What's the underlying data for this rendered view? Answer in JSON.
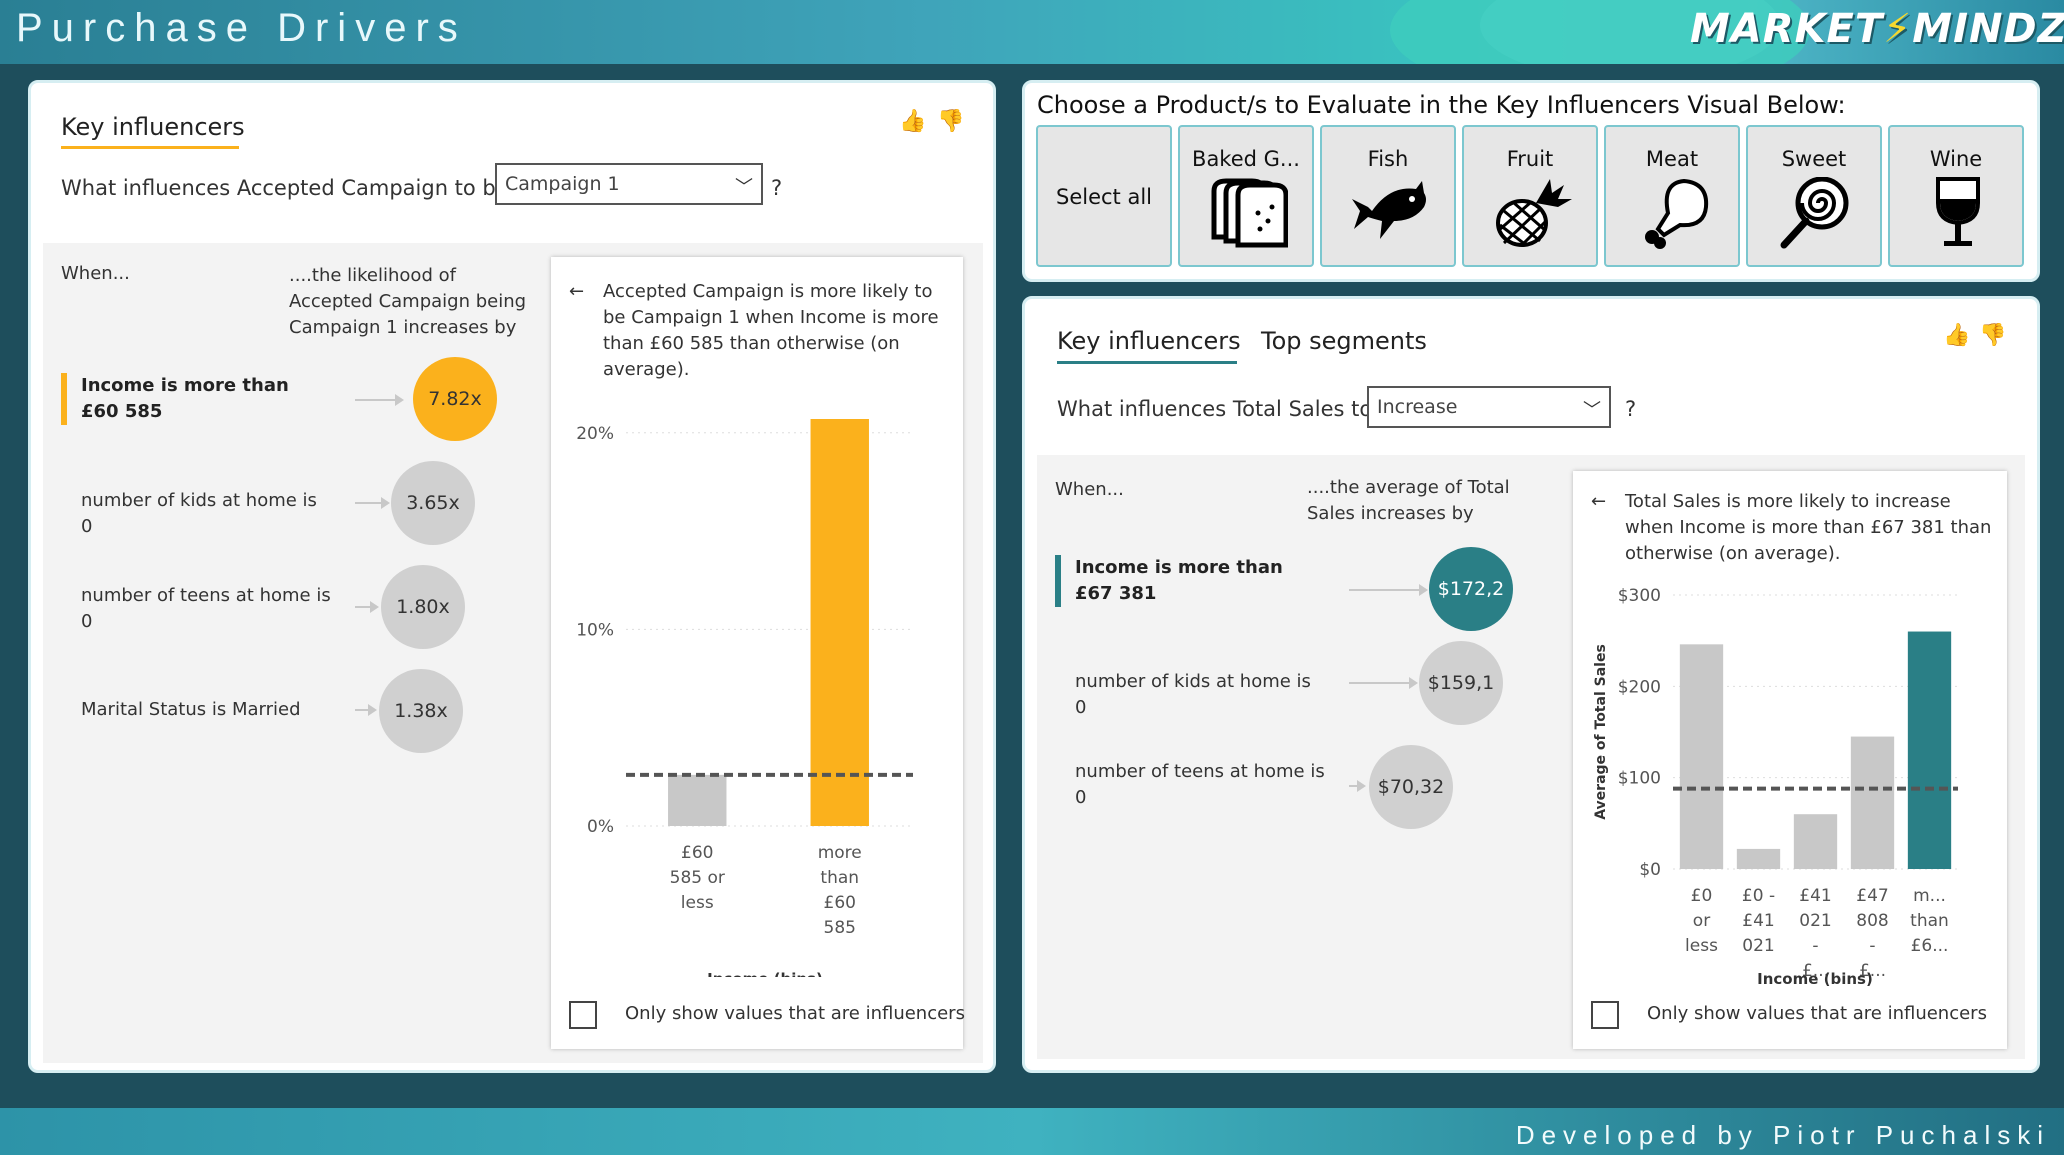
{
  "header": {
    "title": "Purchase Drivers",
    "logo": "MARKETMINDZ",
    "accent_color": "#f7d82e"
  },
  "footer": {
    "credit": "Developed by Piotr Puchalski"
  },
  "left": {
    "tab": "Key influencers",
    "question_prefix": "What influences Accepted Campaign to be",
    "dropdown_value": "Campaign 1",
    "question_suffix": "?",
    "col_when": "When...",
    "col_effect": "....the likelihood of Accepted Campaign being Campaign 1 increases by",
    "influencers": [
      {
        "label": "Income is more than £60 585",
        "value": "7.82x",
        "color": "#fbb11c"
      },
      {
        "label": "number of kids at home is 0",
        "value": "3.65x",
        "color": "#d0d0d0"
      },
      {
        "label": "number of teens at home is 0",
        "value": "1.80x",
        "color": "#d0d0d0"
      },
      {
        "label": "Marital Status is Married",
        "value": "1.38x",
        "color": "#d0d0d0"
      }
    ],
    "detail_text": "Accepted Campaign is more likely to be Campaign 1 when Income is more than £60 585 than otherwise (on average).",
    "back_icon": "arrow-left-icon",
    "only_influencers": "Only show values that are influencers"
  },
  "right": {
    "slicer_title": "Choose a Product/s to Evaluate in the Key Influencers Visual Below:",
    "products": [
      {
        "label": "Select all",
        "icon": ""
      },
      {
        "label": "Baked G...",
        "icon": "bread-icon"
      },
      {
        "label": "Fish",
        "icon": "fish-icon"
      },
      {
        "label": "Fruit",
        "icon": "pineapple-icon"
      },
      {
        "label": "Meat",
        "icon": "drumstick-icon"
      },
      {
        "label": "Sweet",
        "icon": "lollipop-icon"
      },
      {
        "label": "Wine",
        "icon": "wine-glass-icon"
      }
    ],
    "tabs": [
      "Key influencers",
      "Top segments"
    ],
    "question_prefix": "What influences Total Sales to",
    "dropdown_value": "Increase",
    "question_suffix": "?",
    "col_when": "When...",
    "col_effect": "....the average of Total Sales increases by",
    "influencers": [
      {
        "label": "Income is more than £67 381",
        "value": "$172,2",
        "color": "#2a7f86"
      },
      {
        "label": "number of kids at home is 0",
        "value": "$159,1",
        "color": "#d0d0d0"
      },
      {
        "label": "number of teens at home is 0",
        "value": "$70,32",
        "color": "#d0d0d0"
      }
    ],
    "detail_text": "Total Sales is more likely to increase when Income is more than £67 381 than otherwise (on average).",
    "only_influencers": "Only show values that are influencers"
  },
  "chart_data": [
    {
      "type": "bar",
      "categories": [
        "£60 585 or less",
        "more than £60 585"
      ],
      "values": [
        2.6,
        20.7
      ],
      "colors": [
        "#c8c8c8",
        "#fbb11c"
      ],
      "ylim": [
        0,
        20.7
      ],
      "yticks": [
        "0%",
        "10%",
        "20%"
      ],
      "ytick_values": [
        0,
        10,
        20
      ],
      "average_line": 2.6,
      "xlabel": "Income (bins)",
      "ylabel": ""
    },
    {
      "type": "bar",
      "categories": [
        "£0 or less",
        "£0 - £41 021",
        "£41 021 - £...",
        "£47 808 - £...",
        "m... than £6..."
      ],
      "values": [
        246,
        22,
        60,
        145,
        260
      ],
      "colors": [
        "#c8c8c8",
        "#c8c8c8",
        "#c8c8c8",
        "#c8c8c8",
        "#2a7f86"
      ],
      "ylim": [
        0,
        300
      ],
      "yticks": [
        "$0",
        "$100",
        "$200",
        "$300"
      ],
      "ytick_values": [
        0,
        100,
        200,
        300
      ],
      "average_line": 88,
      "xlabel": "Income (bins)",
      "ylabel": "Average of Total Sales"
    }
  ]
}
